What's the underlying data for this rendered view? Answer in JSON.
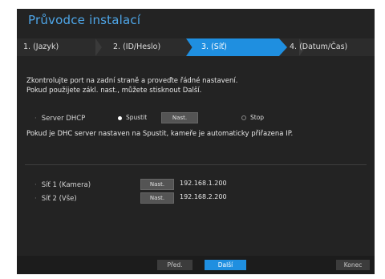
{
  "window": {
    "title": "Průvodce instalací"
  },
  "steps": [
    {
      "label": "1.  (Jazyk)"
    },
    {
      "label": "2.  (ID/Heslo)"
    },
    {
      "label": "3.  (Síť)",
      "active": true
    },
    {
      "label": "4.  (Datum/Čas)"
    }
  ],
  "intro": {
    "line1": "Zkontrolujte port na zadní straně a proveďte řádné nastavení.",
    "line2": "Pokud použijete zákl. nast., můžete stisknout Další."
  },
  "dhcp": {
    "label": "Server DHCP",
    "start_label": "Spustit",
    "settings_label": "Nast.",
    "stop_label": "Stop",
    "selected": "Spustit",
    "note": "Pokud je DHC server nastaven na Spustit, kameře je automaticky přiřazena IP."
  },
  "networks": [
    {
      "label": "Síť 1 (Kamera)",
      "settings_label": "Nast.",
      "ip": "192.168.1.200"
    },
    {
      "label": "Síť 2 (Vše)",
      "settings_label": "Nast.",
      "ip": "192.168.2.200"
    }
  ],
  "footer": {
    "prev_label": "Před.",
    "next_label": "Další",
    "end_label": "Konec"
  },
  "colors": {
    "accent": "#1f8fe0",
    "title": "#4ea6e8",
    "background": "#232323"
  }
}
